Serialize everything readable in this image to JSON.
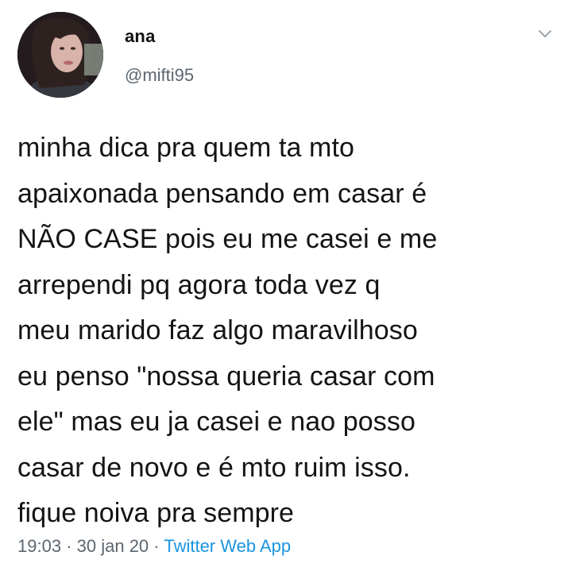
{
  "author": {
    "name": "ana",
    "handle": "@mifti95"
  },
  "tweet": {
    "text": "minha dica pra quem ta mto\napaixonada pensando em casar é\nNÃO CASE pois eu me casei e me\narrependi pq agora toda vez q\nmeu marido faz algo maravilhoso\neu penso \"nossa queria casar com\nele\" mas eu ja casei e nao posso\ncasar de novo e é mto ruim isso.\nfique noiva pra sempre"
  },
  "meta": {
    "time": "19:03",
    "separator": "·",
    "date": "30 jan 20",
    "source": "Twitter Web App"
  },
  "icons": {
    "more": "chevron-down-icon"
  },
  "colors": {
    "text": "#141414",
    "secondary": "#5b6670",
    "link": "#1b95e0",
    "background": "#ffffff"
  }
}
